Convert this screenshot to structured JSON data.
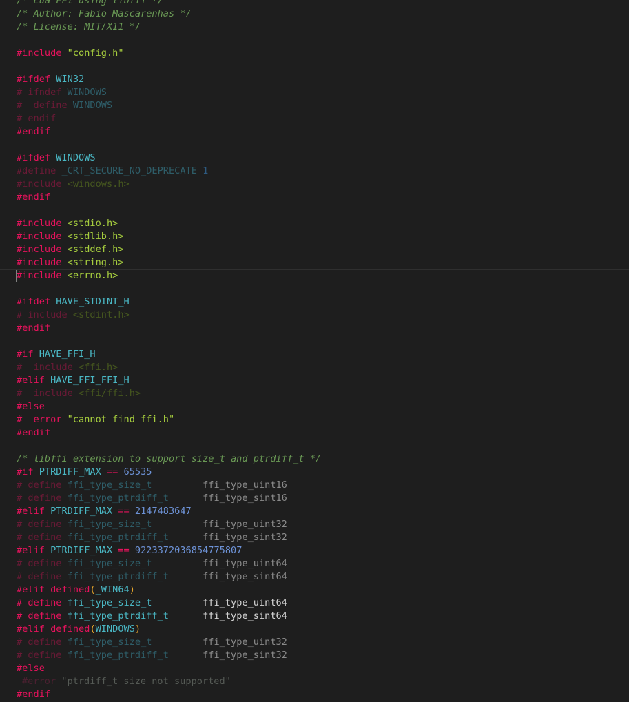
{
  "file": {
    "lines": [
      {
        "k": "normal",
        "tokens": [
          {
            "c": "comment",
            "t": "/* Lua FFI using libffi */"
          }
        ]
      },
      {
        "k": "normal",
        "tokens": [
          {
            "c": "comment",
            "t": "/* Author: Fabio Mascarenhas */"
          }
        ]
      },
      {
        "k": "normal",
        "tokens": [
          {
            "c": "comment",
            "t": "/* License: MIT/X11 */"
          }
        ]
      },
      {
        "k": "normal",
        "tokens": []
      },
      {
        "k": "normal",
        "tokens": [
          {
            "c": "dir",
            "t": "#include "
          },
          {
            "c": "str",
            "t": "\"config.h\""
          }
        ]
      },
      {
        "k": "normal",
        "tokens": []
      },
      {
        "k": "normal",
        "tokens": [
          {
            "c": "dir",
            "t": "#ifdef "
          },
          {
            "c": "id",
            "t": "WIN32"
          }
        ]
      },
      {
        "k": "normal",
        "tokens": [
          {
            "c": "dirdim",
            "t": "# ifndef "
          },
          {
            "c": "iddim",
            "t": "WINDOWS"
          }
        ]
      },
      {
        "k": "normal",
        "tokens": [
          {
            "c": "dirdim",
            "t": "#  define "
          },
          {
            "c": "iddim",
            "t": "WINDOWS"
          }
        ]
      },
      {
        "k": "normal",
        "tokens": [
          {
            "c": "dirdim",
            "t": "# endif"
          }
        ]
      },
      {
        "k": "normal",
        "tokens": [
          {
            "c": "dir",
            "t": "#endif"
          }
        ]
      },
      {
        "k": "normal",
        "tokens": []
      },
      {
        "k": "normal",
        "tokens": [
          {
            "c": "dir",
            "t": "#ifdef "
          },
          {
            "c": "id",
            "t": "WINDOWS"
          }
        ]
      },
      {
        "k": "normal",
        "tokens": [
          {
            "c": "dirdim",
            "t": "#define "
          },
          {
            "c": "iddim",
            "t": "_CRT_SECURE_NO_DEPRECATE "
          },
          {
            "c": "numdim",
            "t": "1"
          }
        ]
      },
      {
        "k": "normal",
        "tokens": [
          {
            "c": "dirdim",
            "t": "#include "
          },
          {
            "c": "strdim",
            "t": "<windows.h>"
          }
        ]
      },
      {
        "k": "normal",
        "tokens": [
          {
            "c": "dir",
            "t": "#endif"
          }
        ]
      },
      {
        "k": "normal",
        "tokens": []
      },
      {
        "k": "normal",
        "tokens": [
          {
            "c": "dir",
            "t": "#include "
          },
          {
            "c": "str",
            "t": "<stdio.h>"
          }
        ]
      },
      {
        "k": "normal",
        "tokens": [
          {
            "c": "dir",
            "t": "#include "
          },
          {
            "c": "str",
            "t": "<stdlib.h>"
          }
        ]
      },
      {
        "k": "normal",
        "tokens": [
          {
            "c": "dir",
            "t": "#include "
          },
          {
            "c": "str",
            "t": "<stddef.h>"
          }
        ]
      },
      {
        "k": "normal",
        "tokens": [
          {
            "c": "dir",
            "t": "#include "
          },
          {
            "c": "str",
            "t": "<string.h>"
          }
        ]
      },
      {
        "k": "current",
        "tokens": [
          {
            "c": "dir",
            "t": "#include "
          },
          {
            "c": "str",
            "t": "<errno.h>"
          }
        ]
      },
      {
        "k": "normal",
        "tokens": []
      },
      {
        "k": "normal",
        "tokens": [
          {
            "c": "dir",
            "t": "#ifdef "
          },
          {
            "c": "id",
            "t": "HAVE_STDINT_H"
          }
        ]
      },
      {
        "k": "normal",
        "tokens": [
          {
            "c": "dirdim",
            "t": "# include "
          },
          {
            "c": "strdim",
            "t": "<stdint.h>"
          }
        ]
      },
      {
        "k": "normal",
        "tokens": [
          {
            "c": "dir",
            "t": "#endif"
          }
        ]
      },
      {
        "k": "normal",
        "tokens": []
      },
      {
        "k": "normal",
        "tokens": [
          {
            "c": "dir",
            "t": "#if "
          },
          {
            "c": "id",
            "t": "HAVE_FFI_H"
          }
        ]
      },
      {
        "k": "normal",
        "tokens": [
          {
            "c": "dirdim",
            "t": "#  include "
          },
          {
            "c": "strdim",
            "t": "<ffi.h>"
          }
        ]
      },
      {
        "k": "normal",
        "tokens": [
          {
            "c": "dir",
            "t": "#elif "
          },
          {
            "c": "id",
            "t": "HAVE_FFI_FFI_H"
          }
        ]
      },
      {
        "k": "normal",
        "tokens": [
          {
            "c": "dirdim",
            "t": "#  include "
          },
          {
            "c": "strdim",
            "t": "<ffi/ffi.h>"
          }
        ]
      },
      {
        "k": "normal",
        "tokens": [
          {
            "c": "dir",
            "t": "#else"
          }
        ]
      },
      {
        "k": "normal",
        "tokens": [
          {
            "c": "dir",
            "t": "#  error "
          },
          {
            "c": "str",
            "t": "\"cannot find ffi.h\""
          }
        ]
      },
      {
        "k": "normal",
        "tokens": [
          {
            "c": "dir",
            "t": "#endif"
          }
        ]
      },
      {
        "k": "normal",
        "tokens": []
      },
      {
        "k": "normal",
        "tokens": [
          {
            "c": "comment",
            "t": "/* libffi extension to support size_t and ptrdiff_t */"
          }
        ]
      },
      {
        "k": "normal",
        "tokens": [
          {
            "c": "dir",
            "t": "#if "
          },
          {
            "c": "id",
            "t": "PTRDIFF_MAX "
          },
          {
            "c": "op",
            "t": "== "
          },
          {
            "c": "num",
            "t": "65535"
          }
        ]
      },
      {
        "k": "normal",
        "tokens": [
          {
            "c": "dirdim",
            "t": "# define "
          },
          {
            "c": "iddim",
            "t": "ffi_type_size_t         "
          },
          {
            "c": "valdim",
            "t": "ffi_type_uint16"
          }
        ]
      },
      {
        "k": "normal",
        "tokens": [
          {
            "c": "dirdim",
            "t": "# define "
          },
          {
            "c": "iddim",
            "t": "ffi_type_ptrdiff_t      "
          },
          {
            "c": "valdim",
            "t": "ffi_type_sint16"
          }
        ]
      },
      {
        "k": "normal",
        "tokens": [
          {
            "c": "dir",
            "t": "#elif "
          },
          {
            "c": "id",
            "t": "PTRDIFF_MAX "
          },
          {
            "c": "op",
            "t": "== "
          },
          {
            "c": "num",
            "t": "2147483647"
          }
        ]
      },
      {
        "k": "normal",
        "tokens": [
          {
            "c": "dirdim",
            "t": "# define "
          },
          {
            "c": "iddim",
            "t": "ffi_type_size_t         "
          },
          {
            "c": "valdim",
            "t": "ffi_type_uint32"
          }
        ]
      },
      {
        "k": "normal",
        "tokens": [
          {
            "c": "dirdim",
            "t": "# define "
          },
          {
            "c": "iddim",
            "t": "ffi_type_ptrdiff_t      "
          },
          {
            "c": "valdim",
            "t": "ffi_type_sint32"
          }
        ]
      },
      {
        "k": "normal",
        "tokens": [
          {
            "c": "dir",
            "t": "#elif "
          },
          {
            "c": "id",
            "t": "PTRDIFF_MAX "
          },
          {
            "c": "op",
            "t": "== "
          },
          {
            "c": "num",
            "t": "9223372036854775807"
          }
        ]
      },
      {
        "k": "normal",
        "tokens": [
          {
            "c": "dirdim",
            "t": "# define "
          },
          {
            "c": "iddim",
            "t": "ffi_type_size_t         "
          },
          {
            "c": "valdim",
            "t": "ffi_type_uint64"
          }
        ]
      },
      {
        "k": "normal",
        "tokens": [
          {
            "c": "dirdim",
            "t": "# define "
          },
          {
            "c": "iddim",
            "t": "ffi_type_ptrdiff_t      "
          },
          {
            "c": "valdim",
            "t": "ffi_type_sint64"
          }
        ]
      },
      {
        "k": "normal",
        "tokens": [
          {
            "c": "dir",
            "t": "#elif "
          },
          {
            "c": "dir",
            "t": "defined"
          },
          {
            "c": "paren",
            "t": "("
          },
          {
            "c": "id",
            "t": "_WIN64"
          },
          {
            "c": "paren",
            "t": ")"
          }
        ]
      },
      {
        "k": "normal",
        "tokens": [
          {
            "c": "dir",
            "t": "# define "
          },
          {
            "c": "id",
            "t": "ffi_type_size_t         "
          },
          {
            "c": "val",
            "t": "ffi_type_uint64"
          }
        ]
      },
      {
        "k": "normal",
        "tokens": [
          {
            "c": "dir",
            "t": "# define "
          },
          {
            "c": "id",
            "t": "ffi_type_ptrdiff_t      "
          },
          {
            "c": "val",
            "t": "ffi_type_sint64"
          }
        ]
      },
      {
        "k": "normal",
        "tokens": [
          {
            "c": "dir",
            "t": "#elif "
          },
          {
            "c": "dir",
            "t": "defined"
          },
          {
            "c": "paren",
            "t": "("
          },
          {
            "c": "id",
            "t": "WINDOWS"
          },
          {
            "c": "paren",
            "t": ")"
          }
        ]
      },
      {
        "k": "normal",
        "tokens": [
          {
            "c": "dirdim",
            "t": "# define "
          },
          {
            "c": "iddim",
            "t": "ffi_type_size_t         "
          },
          {
            "c": "valdim",
            "t": "ffi_type_uint32"
          }
        ]
      },
      {
        "k": "normal",
        "tokens": [
          {
            "c": "dirdim",
            "t": "# define "
          },
          {
            "c": "iddim",
            "t": "ffi_type_ptrdiff_t      "
          },
          {
            "c": "valdim",
            "t": "ffi_type_sint32"
          }
        ]
      },
      {
        "k": "normal",
        "tokens": [
          {
            "c": "dir",
            "t": "#else"
          }
        ]
      },
      {
        "k": "guide",
        "tokens": [
          {
            "c": "dirgray",
            "t": "#error "
          },
          {
            "c": "strgray",
            "t": "\"ptrdiff_t size not supported\""
          }
        ]
      },
      {
        "k": "normal",
        "tokens": [
          {
            "c": "dir",
            "t": "#endif"
          }
        ]
      }
    ]
  }
}
